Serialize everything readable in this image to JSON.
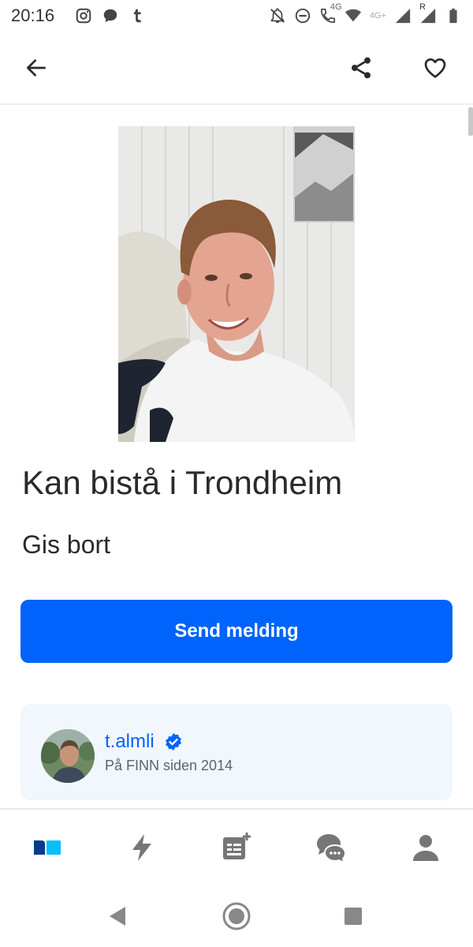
{
  "status_bar": {
    "time": "20:16",
    "left_icons": [
      "instagram-icon",
      "chat-bubble-icon",
      "tumblr-icon"
    ],
    "right_icons": [
      "notifications-off-icon",
      "do-not-disturb-icon",
      "volte-call-icon",
      "wifi-icon",
      "cell-signal-icon",
      "cell-signal-roaming-icon",
      "battery-icon"
    ],
    "net_label_1": "4G",
    "net_label_2": "4G+",
    "roaming_label": "R"
  },
  "app_bar": {
    "back_icon": "arrow-left-icon",
    "share_icon": "share-icon",
    "favorite_icon": "heart-outline-icon"
  },
  "listing": {
    "title": "Kan bistå i Trondheim",
    "price": "Gis bort",
    "cta_label": "Send melding"
  },
  "seller": {
    "name": "t.almli",
    "verified_icon": "verified-badge-icon",
    "since": "På FINN siden 2014"
  },
  "bottom_nav": {
    "items": [
      {
        "icon": "finn-home-icon",
        "active": true
      },
      {
        "icon": "bolt-icon",
        "active": false
      },
      {
        "icon": "new-ad-icon",
        "active": false
      },
      {
        "icon": "messages-icon",
        "active": false
      },
      {
        "icon": "profile-icon",
        "active": false
      }
    ]
  },
  "colors": {
    "primary": "#0063fb",
    "card_bg": "#f1f7fd",
    "nav_icon": "#767676",
    "nav_active": "#0063fb"
  }
}
